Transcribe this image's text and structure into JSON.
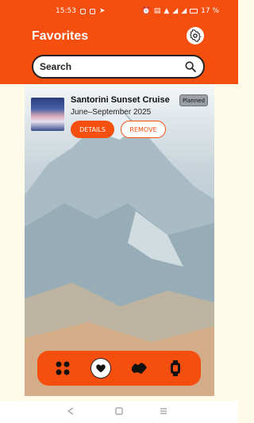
{
  "status_bar": {
    "time": "15:53",
    "battery": "17 %"
  },
  "header": {
    "title": "Favorites"
  },
  "search": {
    "placeholder": "Search"
  },
  "favorites": [
    {
      "title": "Santorini Sunset Cruise",
      "dates": "June–September 2025",
      "status": "Planned",
      "details_label": "DETAILS",
      "remove_label": "REMOVE"
    }
  ],
  "bottom_nav": {
    "items": [
      {
        "icon": "grid-apps-icon",
        "active": false
      },
      {
        "icon": "heart-icon",
        "active": true
      },
      {
        "icon": "map-icon",
        "active": false
      },
      {
        "icon": "watch-icon",
        "active": false
      }
    ]
  },
  "colors": {
    "accent": "#f54f0f",
    "background": "#fffbe8",
    "badge": "#9aa0a6"
  }
}
